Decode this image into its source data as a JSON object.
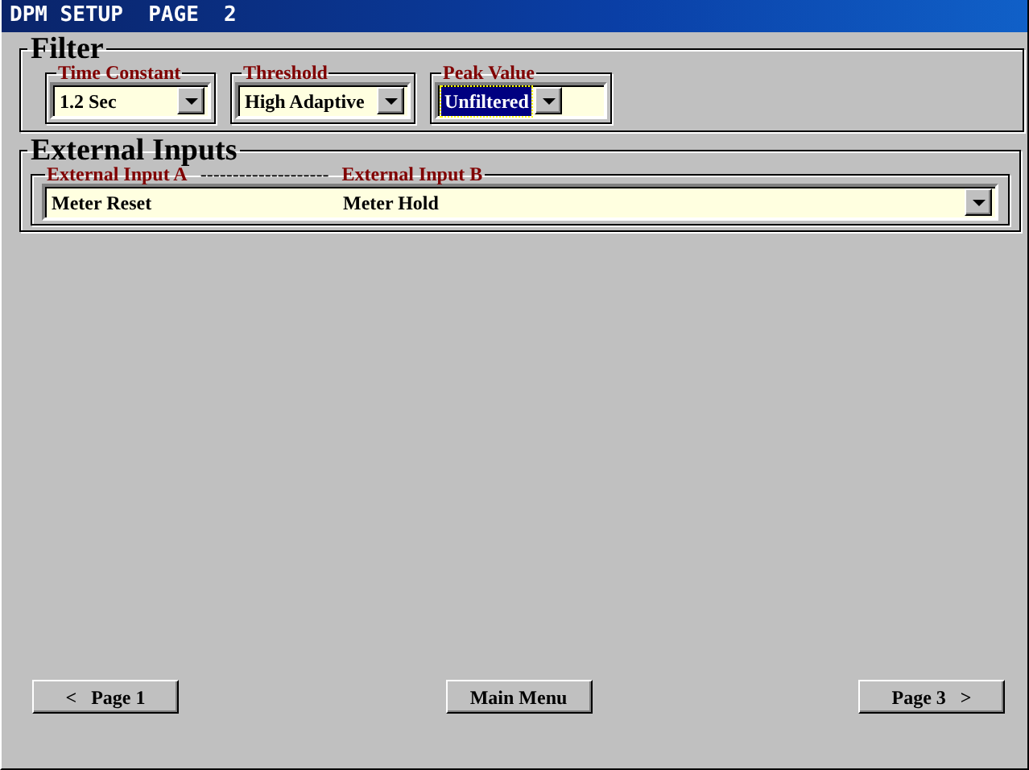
{
  "window": {
    "title": "DPM SETUP  PAGE  2"
  },
  "filter": {
    "title": "Filter",
    "fields": [
      {
        "label": "Time Constant",
        "value": "1.2 Sec",
        "selected": false
      },
      {
        "label": "Threshold",
        "value": "High Adaptive",
        "selected": false
      },
      {
        "label": "Peak Value",
        "value": "Unfiltered",
        "selected": true
      }
    ]
  },
  "external_inputs": {
    "title": "External Inputs",
    "headings": [
      "External Input A",
      "--------------------",
      "External Input B"
    ],
    "values": [
      "Meter Reset",
      "Meter Hold"
    ]
  },
  "buttons": [
    "<   Page 1",
    "Main Menu",
    "Page 3   >"
  ]
}
